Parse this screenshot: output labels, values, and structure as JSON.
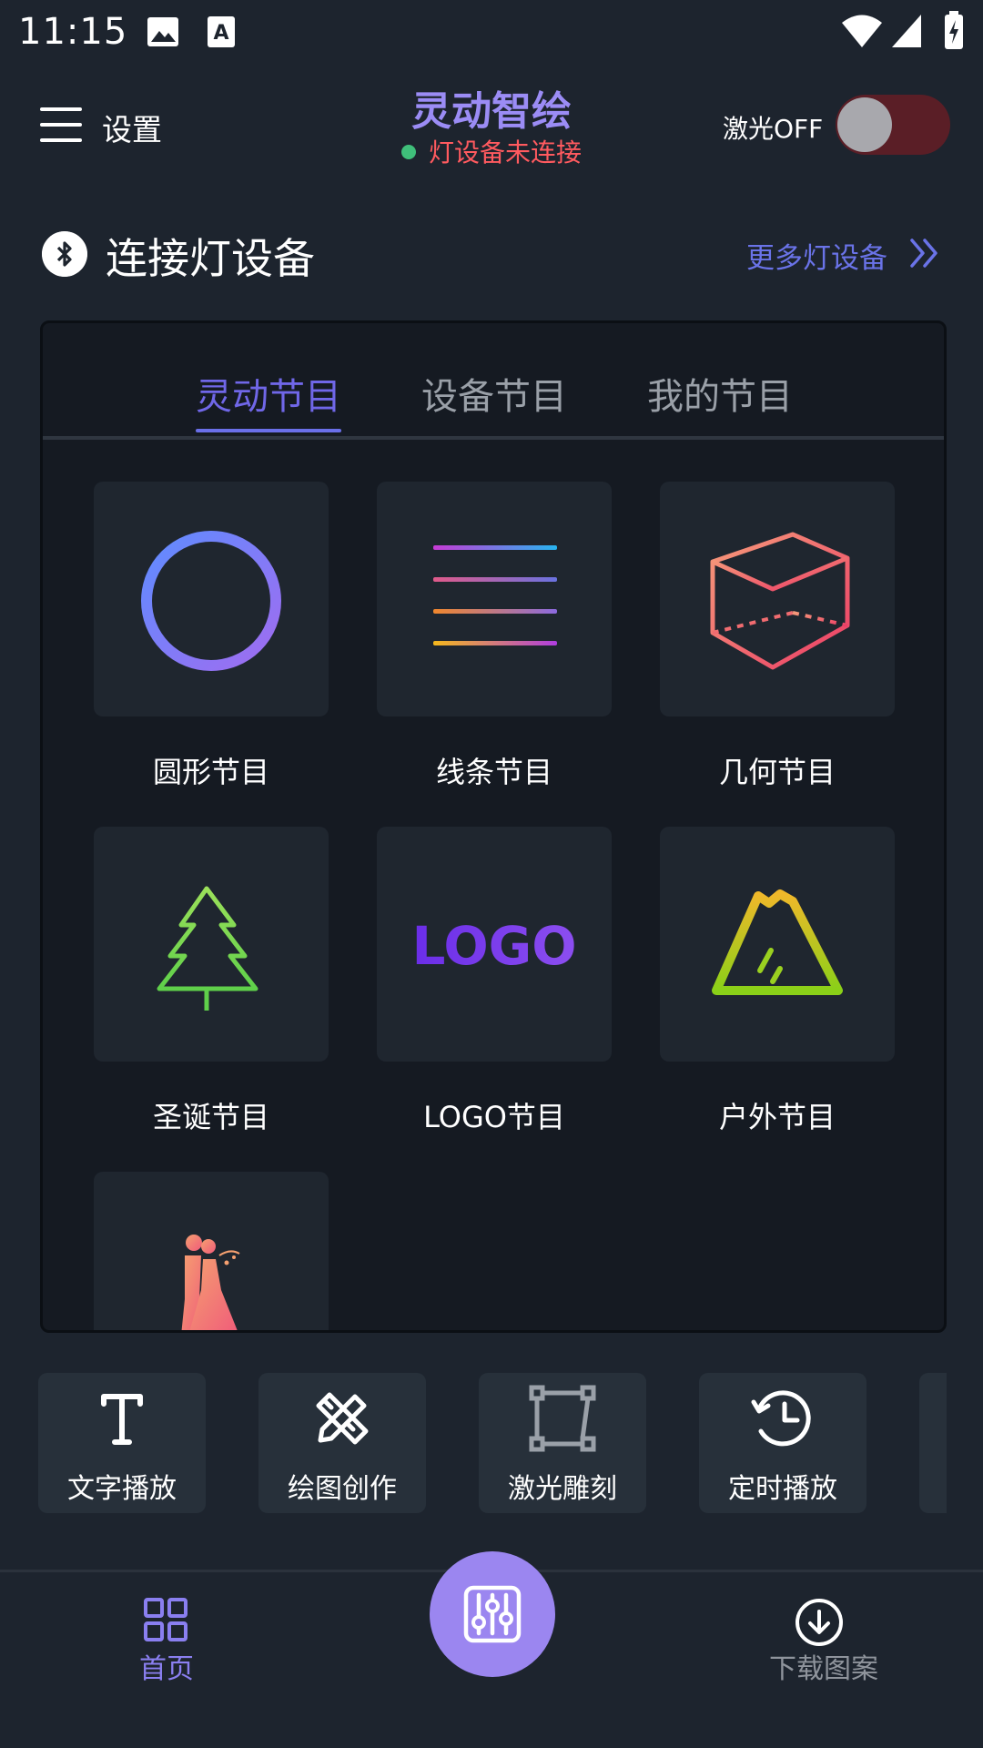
{
  "status_bar": {
    "time": "11:15"
  },
  "header": {
    "menu_icon": "hamburger-menu-icon",
    "settings_label": "设置",
    "app_title": "灵动智绘",
    "connection_status": "灯设备未连接",
    "laser_label": "激光OFF",
    "laser_on": false,
    "colors": {
      "title": "#9b8cf5",
      "status_text": "#ff5a5f",
      "status_dot": "#3fbf7a"
    }
  },
  "connect": {
    "icon": "bluetooth-icon",
    "title": "连接灯设备",
    "more_label": "更多灯设备",
    "more_icon": "double-chevron-right-icon"
  },
  "program_tabs": [
    {
      "label": "灵动节目",
      "active": true
    },
    {
      "label": "设备节目",
      "active": false
    },
    {
      "label": "我的节目",
      "active": false
    }
  ],
  "programs": [
    {
      "label": "圆形节目",
      "icon": "circle-icon"
    },
    {
      "label": "线条节目",
      "icon": "lines-icon"
    },
    {
      "label": "几何节目",
      "icon": "cube-icon"
    },
    {
      "label": "圣诞节目",
      "icon": "christmas-tree-icon"
    },
    {
      "label": "LOGO节目",
      "icon": "logo-text-icon",
      "logo_text": "LOGO"
    },
    {
      "label": "户外节目",
      "icon": "mountain-icon"
    },
    {
      "label": "",
      "icon": "wedding-couple-icon"
    }
  ],
  "features": [
    {
      "label": "文字播放",
      "icon": "text-icon"
    },
    {
      "label": "绘图创作",
      "icon": "draw-tools-icon"
    },
    {
      "label": "激光雕刻",
      "icon": "engrave-frame-icon"
    },
    {
      "label": "定时播放",
      "icon": "timer-icon"
    }
  ],
  "bottom_nav": {
    "home_label": "首页",
    "home_icon": "grid-icon",
    "center_icon": "sliders-icon",
    "download_label": "下载图案",
    "download_icon": "download-icon",
    "active_color": "#8a7ff0"
  }
}
